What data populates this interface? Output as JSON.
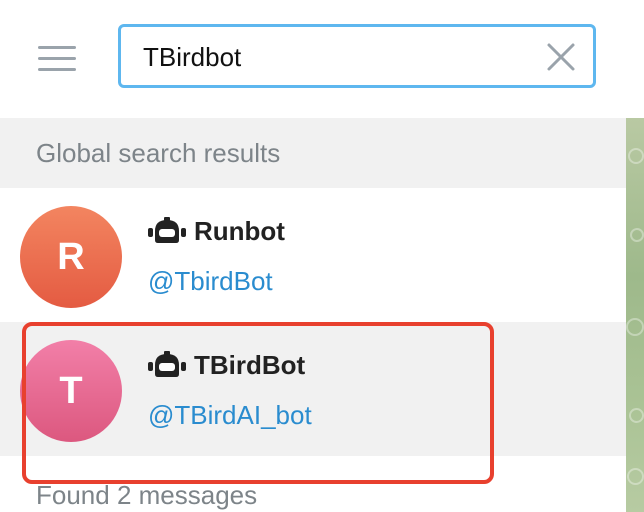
{
  "search": {
    "value": "TBirdbot",
    "placeholder": "Search"
  },
  "section_header": "Global search results",
  "results": [
    {
      "avatar_letter": "R",
      "name": "Runbot",
      "username": "@TbirdBot"
    },
    {
      "avatar_letter": "T",
      "name": "TBirdBot",
      "username": "@TBirdAI_bot"
    }
  ],
  "footer": "Found 2 messages",
  "colors": {
    "search_border": "#5eb7ef",
    "link": "#2a8ccf",
    "highlight": "#e8402e",
    "avatar_r": "#e45b42",
    "avatar_t": "#dc587f"
  },
  "icons": {
    "menu": "hamburger-menu-icon",
    "clear": "close-icon",
    "bot": "bot-icon"
  }
}
